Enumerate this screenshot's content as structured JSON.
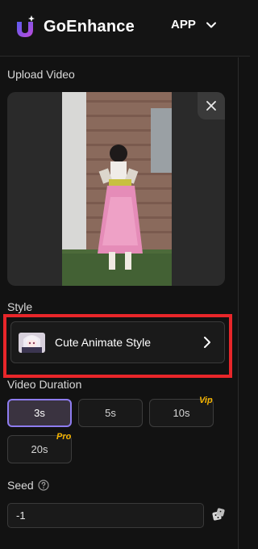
{
  "header": {
    "brand": "GoEnhance",
    "app_menu_label": "APP"
  },
  "upload": {
    "label": "Upload Video"
  },
  "style": {
    "label": "Style",
    "selected_name": "Cute Animate Style"
  },
  "duration": {
    "label": "Video Duration",
    "options": [
      {
        "label": "3s",
        "selected": true,
        "tag": ""
      },
      {
        "label": "5s",
        "selected": false,
        "tag": ""
      },
      {
        "label": "10s",
        "selected": false,
        "tag": "Vip"
      },
      {
        "label": "20s",
        "selected": false,
        "tag": "Pro"
      }
    ]
  },
  "seed": {
    "label": "Seed",
    "value": "-1"
  },
  "colors": {
    "accent": "#8e7cf0",
    "highlight": "#e8262a",
    "tag": "#f5b400",
    "background": "#121212"
  }
}
